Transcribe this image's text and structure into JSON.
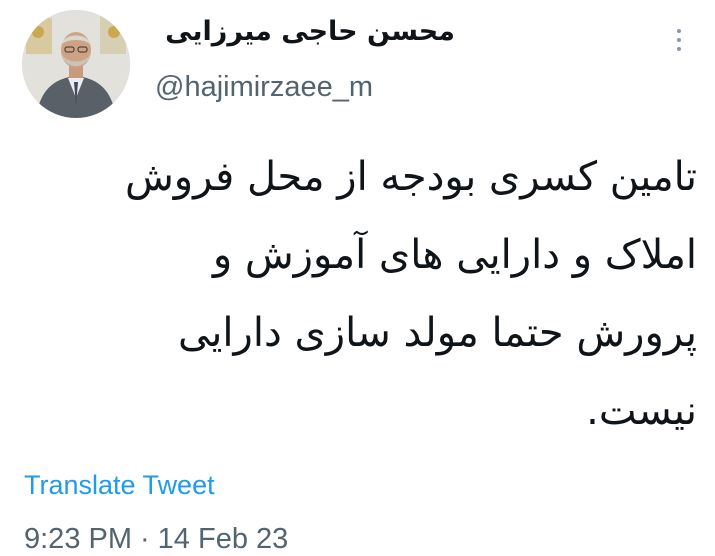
{
  "user": {
    "display_name": "محسن حاجی میرزایی",
    "handle": "@hajimirzaee_m"
  },
  "tweet": {
    "lines": [
      "تامین کسری بودجه از محل فروش",
      "املاک و دارایی های آموزش و",
      "پرورش حتما مولد سازی دارایی",
      "نیست."
    ],
    "translate_label": "Translate Tweet",
    "time": "9:23 PM",
    "separator": "·",
    "date": "14 Feb 23"
  },
  "icons": {
    "more": "more-options-icon"
  },
  "colors": {
    "link": "#1d9bf0",
    "secondary_text": "#536471",
    "primary_text": "#0f1419"
  }
}
